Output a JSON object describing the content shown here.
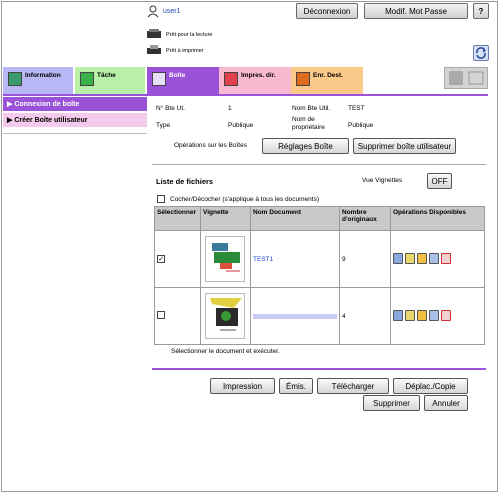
{
  "header": {
    "user": "user1",
    "logout": "Déconnexion",
    "change_password": "Modif. Mot Passe",
    "help": "?",
    "status_read": "Prêt pour la lecture",
    "status_print": "Prêt à imprimer"
  },
  "tabs": [
    {
      "label": "Information",
      "color": "#b7b7f5"
    },
    {
      "label": "Tâche",
      "color": "#b8f0a8"
    },
    {
      "label": "Boîte",
      "color": "#9a52d8"
    },
    {
      "label": "Impres. dir.",
      "color": "#f7b8d0"
    },
    {
      "label": "Enr. Dest.",
      "color": "#fbc98a"
    }
  ],
  "sidebar": {
    "items": [
      {
        "label": "Connexion de boîte"
      },
      {
        "label": "Créer Boîte utilisateur"
      }
    ]
  },
  "box_info": {
    "num_label": "N° Bte Ut.",
    "num_value": "1",
    "name_label": "Nom Bte Util.",
    "name_value": "TEST",
    "type_label": "Type",
    "type_value": "Publique",
    "owner_label_1": "Nom de",
    "owner_label_2": "propriétaire",
    "owner_value": "Publique",
    "ops_label": "Opérations sur les Boîtes",
    "settings_button": "Réglages Boîte",
    "delete_button": "Supprimer boîte utilisateur"
  },
  "files": {
    "title": "Liste de fichiers",
    "thumb_view_label": "Vue Vignettes",
    "thumb_view_value": "OFF",
    "check_all": "Cocher/Décocher (s'applique à tous les documents)",
    "columns": [
      "Sélectionner",
      "Vignette",
      "Nom Document",
      "Nombre d'originaux",
      "Opérations Disponibles"
    ],
    "rows": [
      {
        "checked": true,
        "checkmark": "✓",
        "name": "TEST1",
        "count": "9"
      },
      {
        "checked": false,
        "checkmark": "",
        "name": "",
        "count": "4"
      }
    ],
    "instruction": "Sélectionner le document et exécuter."
  },
  "actions": {
    "print": "Impression",
    "send": "Émis.",
    "download": "Télécharger",
    "move_copy": "Déplac./Copie",
    "delete": "Supprimer",
    "cancel": "Annuler"
  }
}
